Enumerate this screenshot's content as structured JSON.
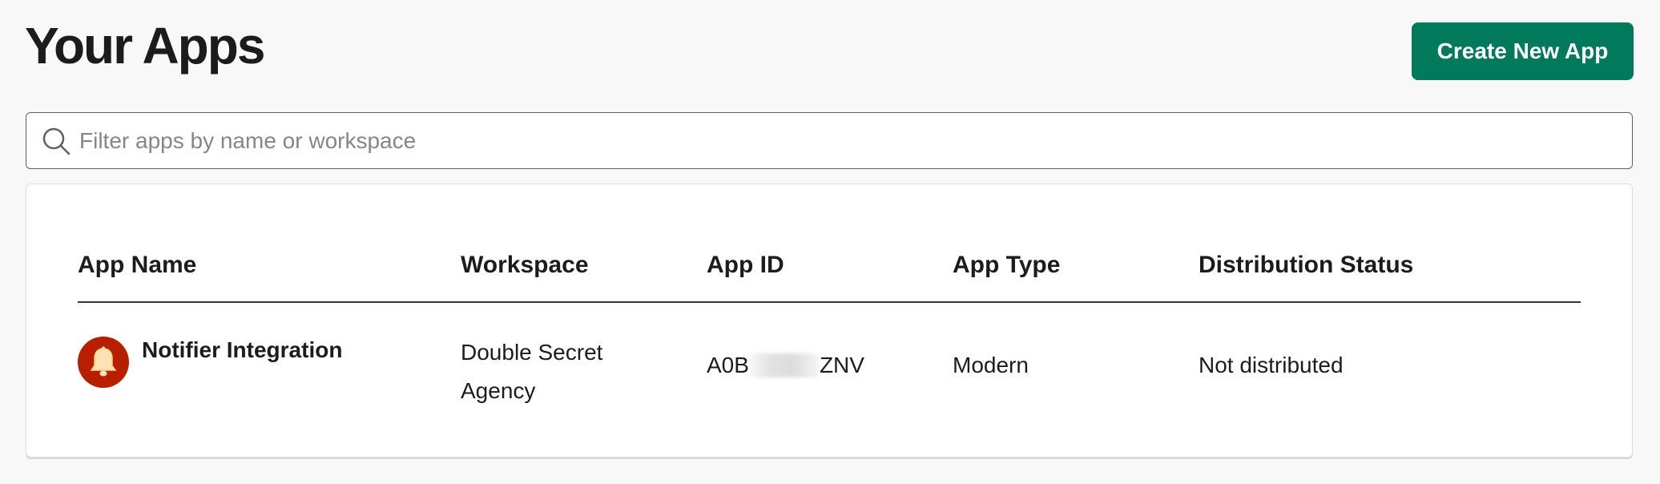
{
  "header": {
    "title": "Your Apps",
    "create_button_label": "Create New App"
  },
  "search": {
    "placeholder": "Filter apps by name or workspace",
    "value": ""
  },
  "table": {
    "columns": [
      "App Name",
      "Workspace",
      "App ID",
      "App Type",
      "Distribution Status"
    ],
    "rows": [
      {
        "icon": "bell-icon",
        "app_name": "Notifier Integration",
        "workspace": "Double Secret Agency",
        "app_id_prefix": "A0B",
        "app_id_suffix": "ZNV",
        "app_type": "Modern",
        "distribution_status": "Not distributed"
      }
    ]
  },
  "colors": {
    "primary_button": "#007a5a",
    "app_icon_bg": "#b81e00",
    "page_bg": "#f8f8f8"
  }
}
